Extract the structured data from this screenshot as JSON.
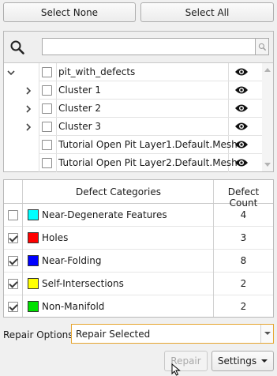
{
  "top_buttons": {
    "select_none": "Select None",
    "select_all": "Select All"
  },
  "search": {
    "placeholder": "",
    "value": "",
    "icon": "search-icon"
  },
  "tree": {
    "items": [
      {
        "label": "pit_with_defects",
        "expander": "collapse",
        "checked": false,
        "visible": true
      },
      {
        "label": "Cluster 1",
        "expander": "expand",
        "checked": false,
        "visible": true
      },
      {
        "label": "Cluster 2",
        "expander": "expand",
        "checked": false,
        "visible": true
      },
      {
        "label": "Cluster 3",
        "expander": "expand",
        "checked": false,
        "visible": true
      },
      {
        "label": "Tutorial Open Pit Layer1.Default.Mesh",
        "expander": "none",
        "checked": false,
        "visible": true
      },
      {
        "label": "Tutorial Open Pit Layer2.Default.Mesh",
        "expander": "none",
        "checked": false,
        "visible": true
      }
    ]
  },
  "defect_table": {
    "headers": {
      "category": "Defect Categories",
      "count": "Defect Count"
    },
    "rows": [
      {
        "name": "Near-Degenerate Features",
        "count": "4",
        "checked": false,
        "color": "#00ffff"
      },
      {
        "name": "Holes",
        "count": "3",
        "checked": true,
        "color": "#ff0000"
      },
      {
        "name": "Near-Folding",
        "count": "8",
        "checked": true,
        "color": "#0000ff"
      },
      {
        "name": "Self-Intersections",
        "count": "2",
        "checked": true,
        "color": "#ffff00"
      },
      {
        "name": "Non-Manifold",
        "count": "2",
        "checked": true,
        "color": "#00e000"
      }
    ]
  },
  "repair": {
    "label": "Repair Options:",
    "selected": "Repair Selected"
  },
  "bottom_buttons": {
    "repair": "Repair",
    "settings": "Settings"
  },
  "colors": {
    "accent_border": "#e5a42e",
    "disabled_text": "#a9a9a9"
  }
}
